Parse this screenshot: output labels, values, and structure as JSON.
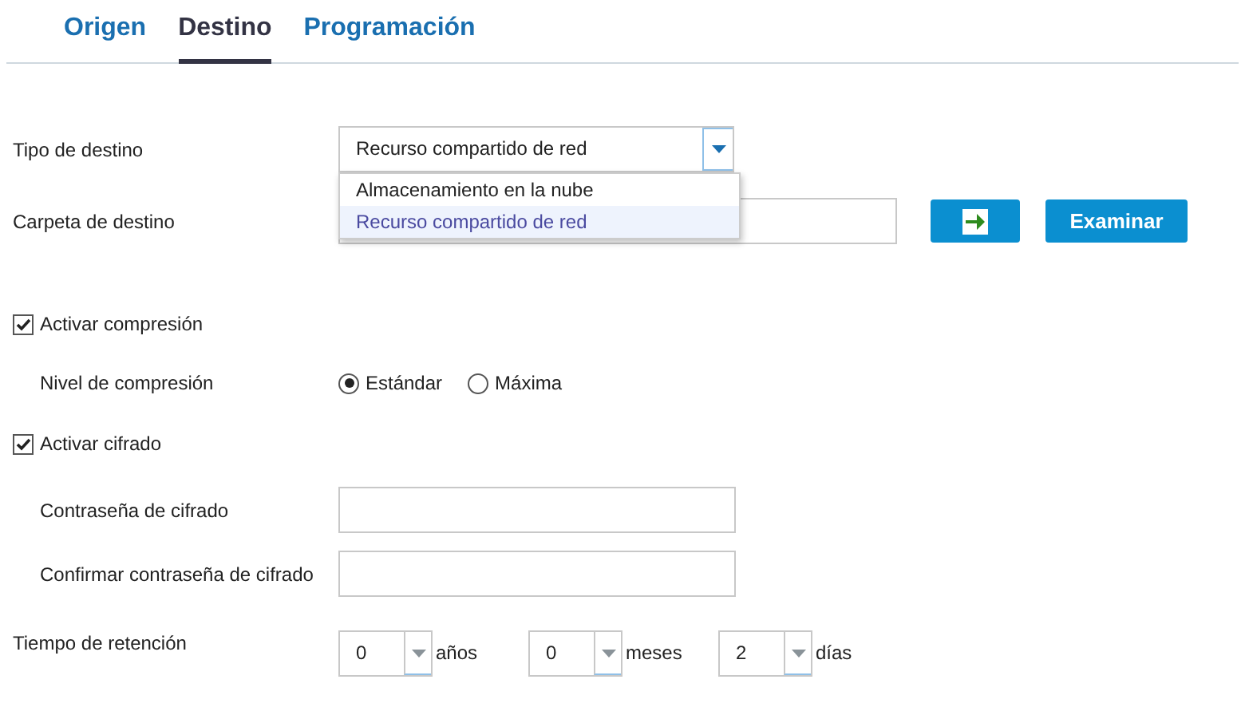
{
  "tabs": [
    {
      "label": "Origen",
      "selected": false
    },
    {
      "label": "Destino",
      "selected": true
    },
    {
      "label": "Programación",
      "selected": false
    }
  ],
  "destination_type": {
    "label": "Tipo de destino",
    "value": "Recurso compartido de red",
    "options": [
      {
        "label": "Almacenamiento en la nube",
        "selected": false
      },
      {
        "label": "Recurso compartido de red",
        "selected": true
      }
    ]
  },
  "destination_folder": {
    "label": "Carpeta de destino",
    "browse_button": "Examinar"
  },
  "compression": {
    "label": "Activar compresión",
    "checked": true,
    "level_label": "Nivel de compresión",
    "levels": [
      {
        "label": "Estándar",
        "selected": true
      },
      {
        "label": "Máxima",
        "selected": false
      }
    ]
  },
  "encryption": {
    "label": "Activar cifrado",
    "checked": true,
    "password_label": "Contraseña de cifrado",
    "confirm_label": "Confirmar contraseña de cifrado"
  },
  "retention": {
    "label": "Tiempo de retención",
    "fields": [
      {
        "value": "0",
        "unit": "años"
      },
      {
        "value": "0",
        "unit": "meses"
      },
      {
        "value": "2",
        "unit": "días"
      }
    ]
  }
}
